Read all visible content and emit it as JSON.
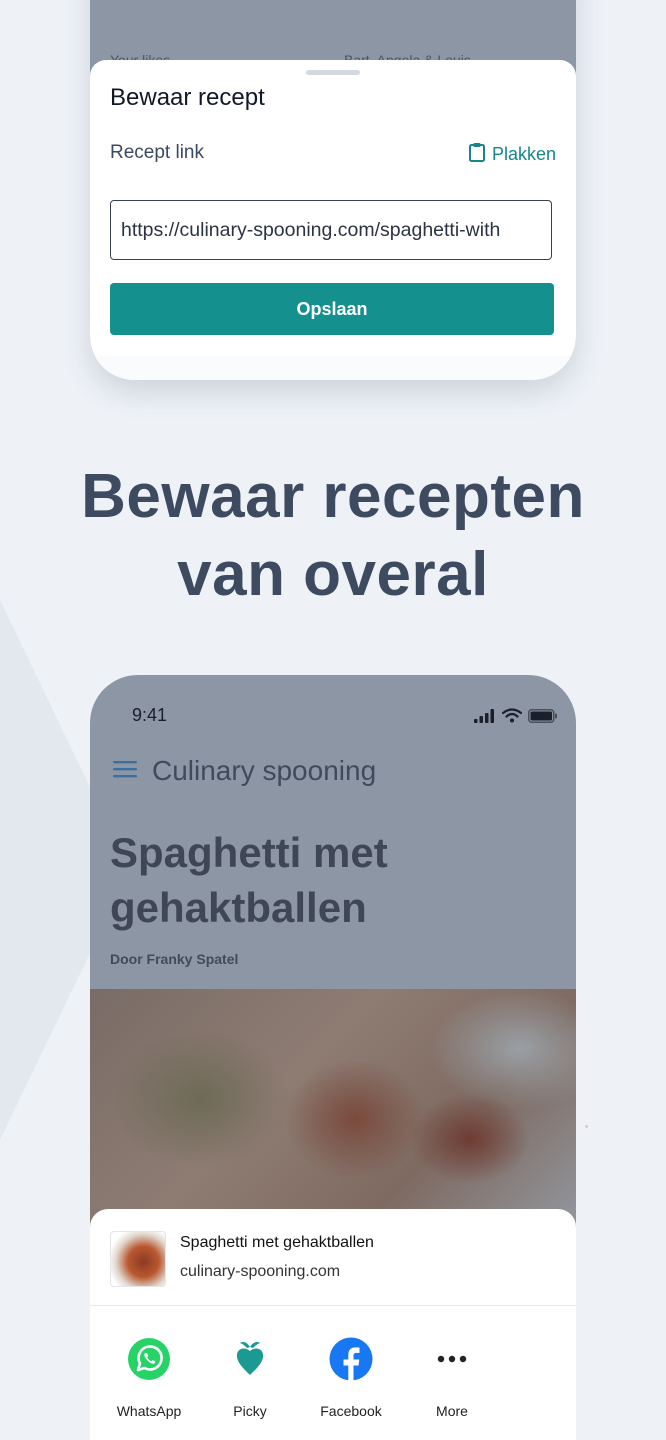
{
  "top_phone": {
    "thumbnails": [
      {
        "caption": "Your likes"
      },
      {
        "caption": "Bart, Angela & Louis"
      }
    ],
    "save_sheet": {
      "title": "Bewaar recept",
      "field_label": "Recept link",
      "paste_label": "Plakken",
      "url_value": "https://culinary-spooning.com/spaghetti-with",
      "save_button": "Opslaan"
    }
  },
  "headline": {
    "line1": "Bewaar recepten",
    "line2": "van overal"
  },
  "bottom_phone": {
    "status_time": "9:41",
    "site_name": "Culinary spooning",
    "article_title": "Spaghetti met gehaktballen",
    "author": "Door Franky Spatel",
    "share": {
      "title": "Spaghetti met gehaktballen",
      "url": "culinary-spooning.com",
      "apps": [
        {
          "label": "WhatsApp",
          "icon": "whatsapp-icon",
          "color": "#25d366"
        },
        {
          "label": "Picky",
          "icon": "picky-icon",
          "color": "#1a9a92"
        },
        {
          "label": "Facebook",
          "icon": "facebook-icon",
          "color": "#1877f2"
        },
        {
          "label": "More",
          "icon": "more-icon",
          "color": "#222222"
        }
      ]
    }
  }
}
